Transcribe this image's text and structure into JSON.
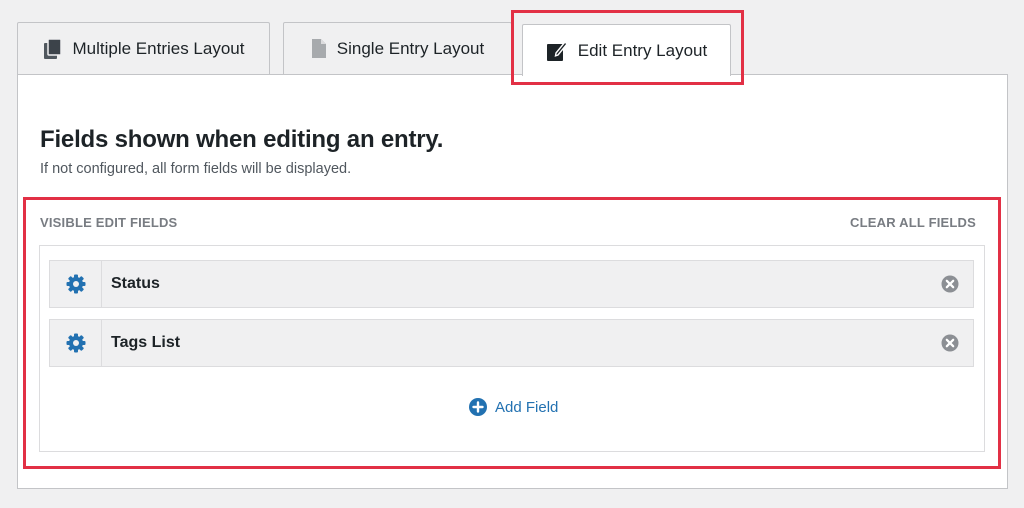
{
  "tabs": [
    {
      "label": "Multiple Entries Layout",
      "icon": "multiple-documents-icon",
      "active": false
    },
    {
      "label": "Single Entry Layout",
      "icon": "document-icon",
      "active": false
    },
    {
      "label": "Edit Entry Layout",
      "icon": "edit-document-icon",
      "active": true
    }
  ],
  "panel": {
    "title": "Fields shown when editing an entry.",
    "subtitle": "If not configured, all form fields will be displayed."
  },
  "fields_section": {
    "label": "VISIBLE EDIT FIELDS",
    "clear_all_label": "CLEAR ALL FIELDS",
    "fields": [
      {
        "label": "Status",
        "settings_icon": "gear-icon",
        "remove_icon": "remove-circle-icon"
      },
      {
        "label": "Tags List",
        "settings_icon": "gear-icon",
        "remove_icon": "remove-circle-icon"
      }
    ],
    "add_field_label": "Add Field",
    "add_field_icon": "plus-circle-icon"
  },
  "colors": {
    "highlight": "#e23045",
    "accent": "#2271b1",
    "remove_icon": "#8c8f94"
  }
}
